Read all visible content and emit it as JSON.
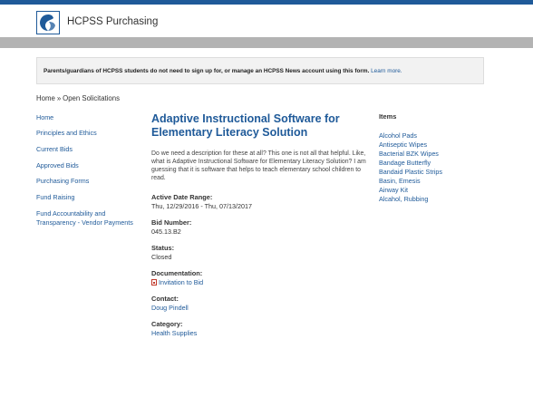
{
  "header": {
    "site_title": "HCPSS Purchasing",
    "logo_icon": "hcpss-logo-icon",
    "brand_color": "#1f5a99"
  },
  "notice": {
    "text": "Parents/guardians of HCPSS students do not need to sign up for, or manage an HCPSS News account using this form.",
    "link": "Learn more."
  },
  "breadcrumb": {
    "home": "Home",
    "separator": "»",
    "current": "Open Solicitations"
  },
  "sidebar": {
    "items": [
      {
        "label": "Home"
      },
      {
        "label": "Principles and Ethics"
      },
      {
        "label": "Current Bids"
      },
      {
        "label": "Approved Bids"
      },
      {
        "label": "Purchasing Forms"
      },
      {
        "label": "Fund Raising"
      },
      {
        "label": "Fund Accountability and Transparency - Vendor Payments"
      }
    ]
  },
  "main": {
    "title": "Adaptive Instructional Software for Elementary Literacy Solution",
    "description": "Do we need a description for these at all? This one is not all that helpful. Like, what is Adaptive Instructional Software for Elementary Literacy Solution? I am guessing that it is software that helps to teach elementary school children to read.",
    "active_date_label": "Active Date Range:",
    "active_date_value": "Thu, 12/29/2016 - Thu, 07/13/2017",
    "bid_number_label": "Bid Number:",
    "bid_number_value": "045.13.B2",
    "status_label": "Status:",
    "status_value": "Closed",
    "documentation_label": "Documentation:",
    "documentation_link": "Invitation to Bid",
    "documentation_icon": "pdf-file-icon",
    "contact_label": "Contact:",
    "contact_link": "Doug Pindell",
    "category_label": "Category:",
    "category_link": "Health Supplies"
  },
  "items": {
    "title": "Items",
    "list": [
      "Alcohol Pads",
      "Antiseptic Wipes",
      "Bacterial BZK Wipes",
      "Bandage Butterfly",
      "Bandaid Plastic Strips",
      "Basin, Emesis",
      "Airway Kit",
      "Alcahol, Rubbing"
    ]
  }
}
